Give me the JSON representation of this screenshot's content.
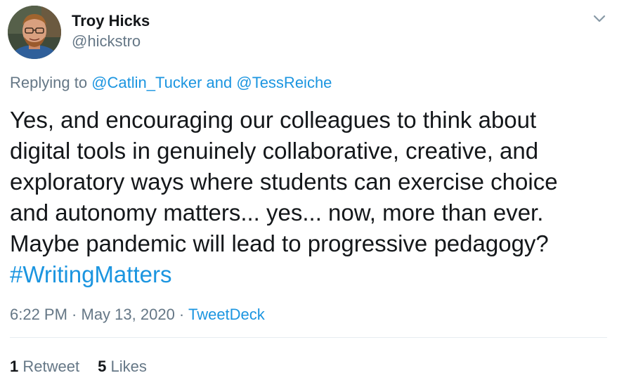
{
  "author": {
    "name": "Troy Hicks",
    "handle": "@hickstro"
  },
  "reply": {
    "prefix": "Replying to ",
    "user1": "@Catlin_Tucker",
    "joiner": " and ",
    "user2": "@TessReiche"
  },
  "tweet": {
    "lines": [
      "Yes, and encouraging our colleagues to think about",
      "digital tools in genuinely collaborative, creative, and",
      "exploratory ways where students can exercise choice",
      "and autonomy matters... yes... now, more than ever.",
      "Maybe pandemic will lead to progressive pedagogy?"
    ],
    "hashtag": "#WritingMatters"
  },
  "meta": {
    "time": "6:22 PM",
    "separator": " · ",
    "date": "May 13, 2020",
    "source": "TweetDeck"
  },
  "stats": {
    "retweets_count": "1",
    "retweets_label": "Retweet",
    "likes_count": "5",
    "likes_label": "Likes"
  },
  "icons": {
    "menu": "chevron-down-icon",
    "avatar": "profile-photo"
  },
  "colors": {
    "link": "#1b95e0",
    "secondary_text": "#657786",
    "primary_text": "#14171a",
    "divider": "#e6ecf0"
  }
}
